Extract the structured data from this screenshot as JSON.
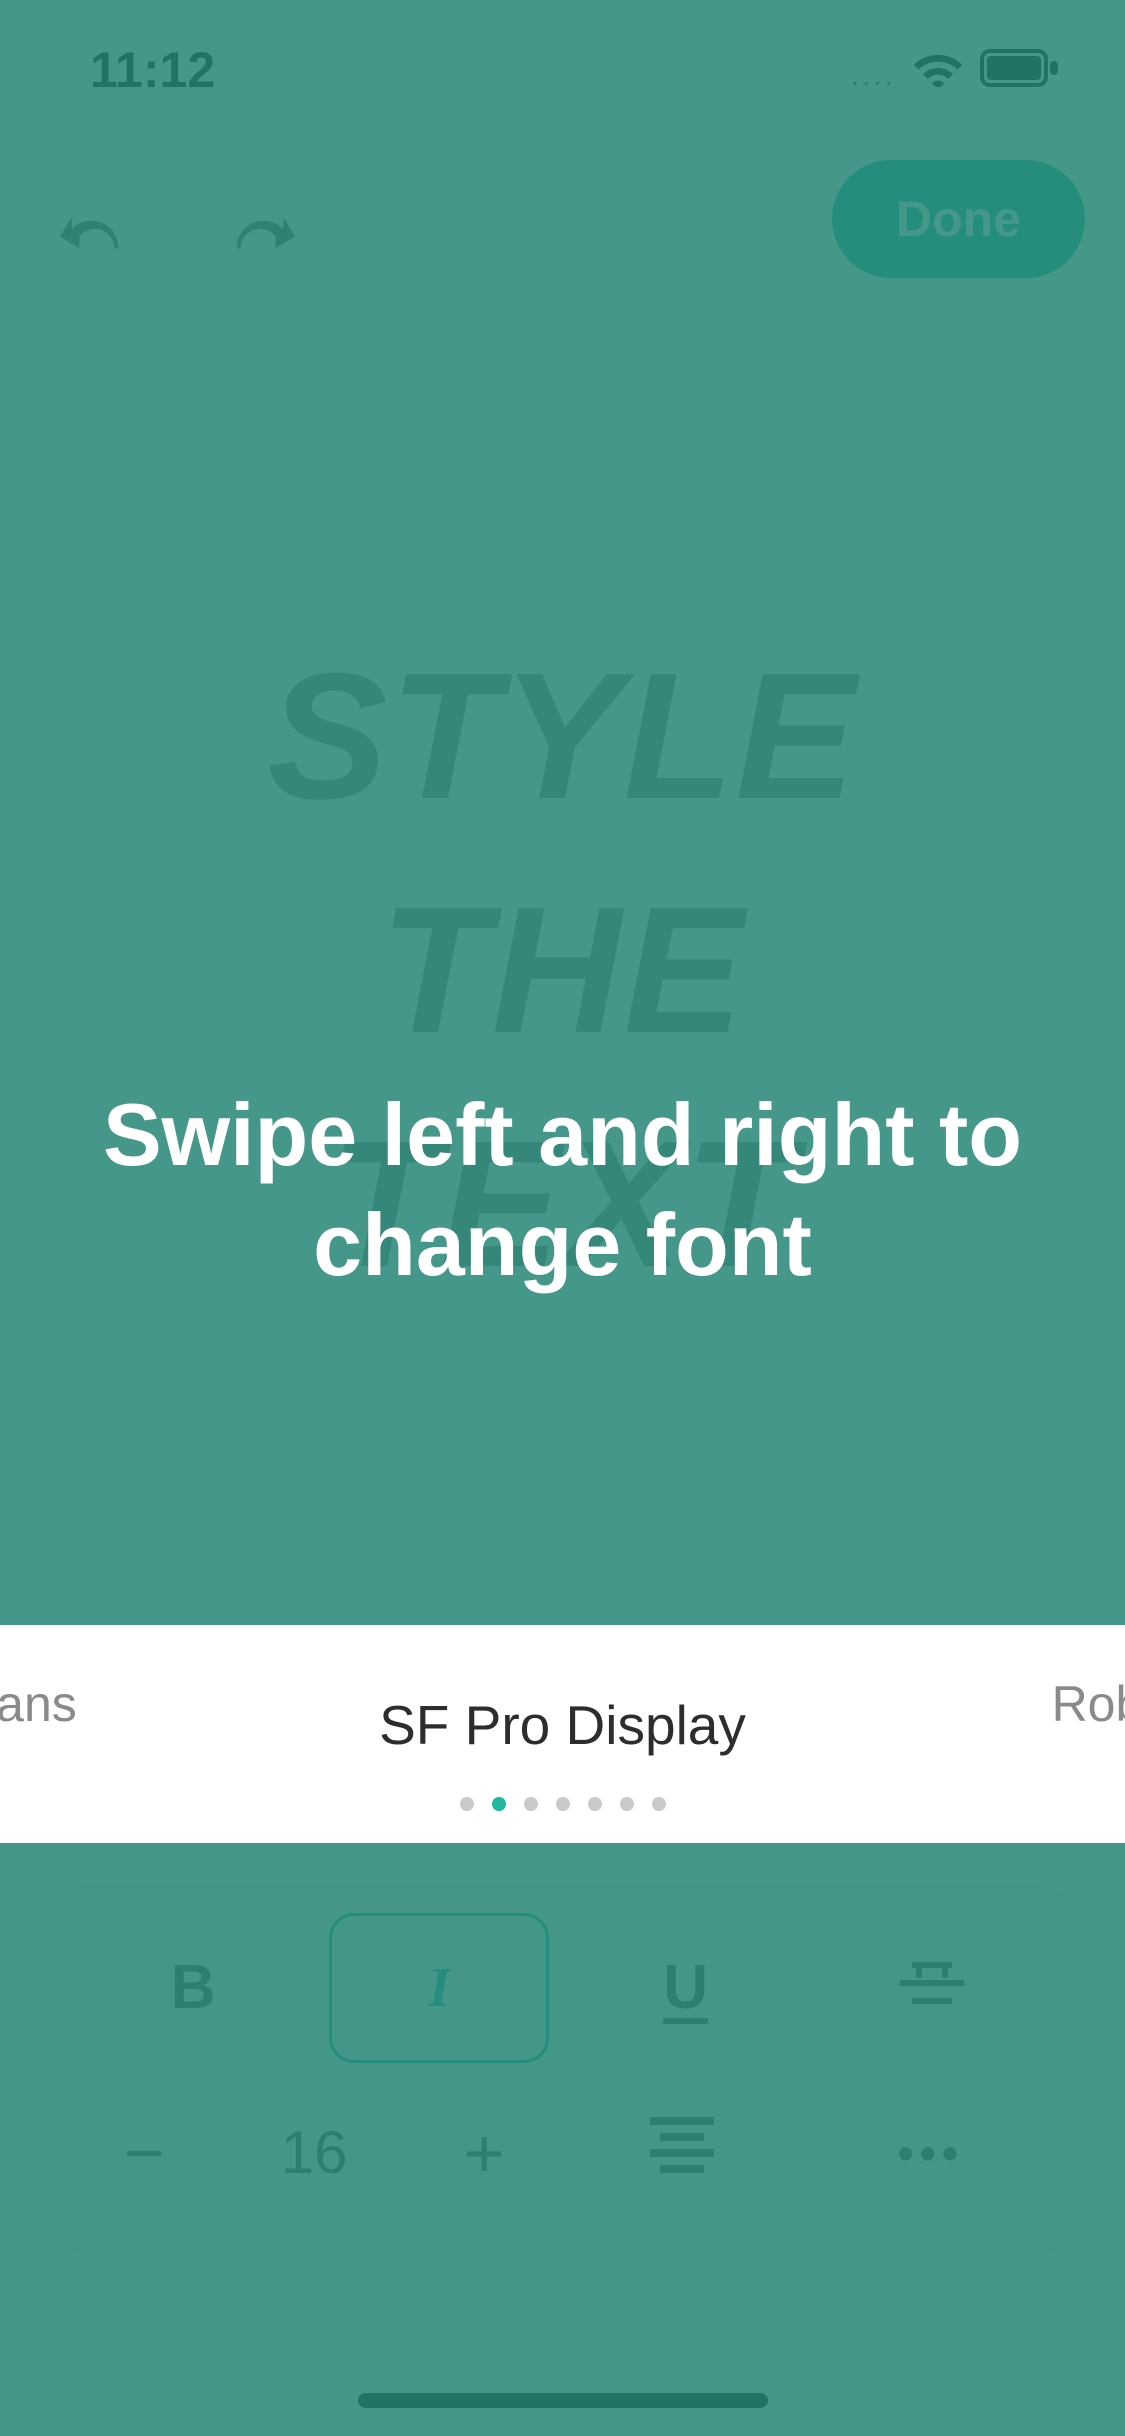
{
  "status": {
    "time": "11:12"
  },
  "topbar": {
    "done_label": "Done"
  },
  "canvas": {
    "line1": "STYLE",
    "line2": "THE",
    "line3": "TEXT"
  },
  "coach": {
    "text": "Swipe left and right to change font"
  },
  "fonts": {
    "prev_partial": ": Sans",
    "current": "SF Pro Display",
    "next_partial": "Robot",
    "page_count": 7,
    "active_index": 1
  },
  "toolbar": {
    "bold": "B",
    "italic": "I",
    "font_size": "16",
    "minus": "−",
    "plus": "+",
    "more": "•••"
  }
}
